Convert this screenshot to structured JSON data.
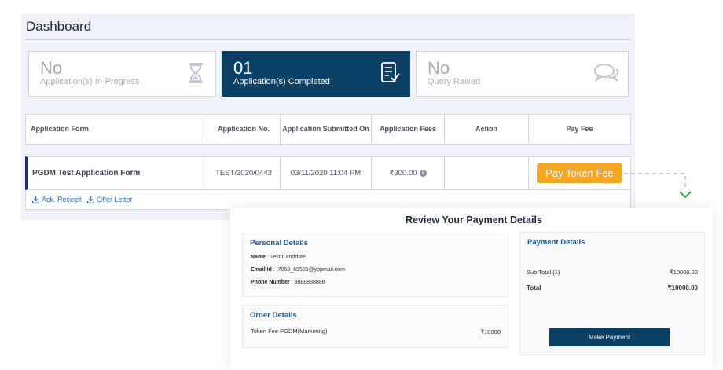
{
  "dashboard": {
    "title": "Dashboard",
    "cards": [
      {
        "count": "No",
        "label": "Application(s) In-Progress",
        "icon": "hourglass-icon"
      },
      {
        "count": "01",
        "label": "Application(s) Completed",
        "icon": "checklist-icon"
      },
      {
        "count": "No",
        "label": "Query Raised",
        "icon": "chat-bubbles-icon"
      }
    ],
    "table": {
      "headers": [
        "Application Form",
        "Application No.",
        "Application Submitted On",
        "Application Fees",
        "Action",
        "Pay Fee"
      ],
      "rows": [
        {
          "form": "PGDM Test Application Form",
          "app_no": "TEST/2020/0443",
          "submitted_on": "03/11/2020 11:04 PM",
          "fees": "₹300.00",
          "action": "",
          "pay_label": "Pay Token Fee"
        }
      ],
      "links": [
        "Ack. Receipt",
        "Offer Letter"
      ]
    }
  },
  "review": {
    "title": "Review Your Payment Details",
    "personal": {
      "heading": "Personal Details",
      "name_label": "Name",
      "name": "Test Canddate",
      "email_label": "Email Id",
      "email": "t7868_69505@yopmail.com",
      "phone_label": "Phone Number",
      "phone": "8888888888"
    },
    "order": {
      "heading": "Order Details",
      "item": "Token Fee PGDM(Marketing)",
      "price": "₹10000"
    },
    "payment": {
      "heading": "Payment Details",
      "subtotal_label": "Sub Total (1)",
      "subtotal": "₹10000.00",
      "total_label": "Total",
      "total": "₹10000.00",
      "button": "Make Payment"
    }
  },
  "colors": {
    "primary": "#0b3f64",
    "accent": "#f5a623",
    "link": "#2a6db5",
    "connector": "#3cae3c"
  }
}
